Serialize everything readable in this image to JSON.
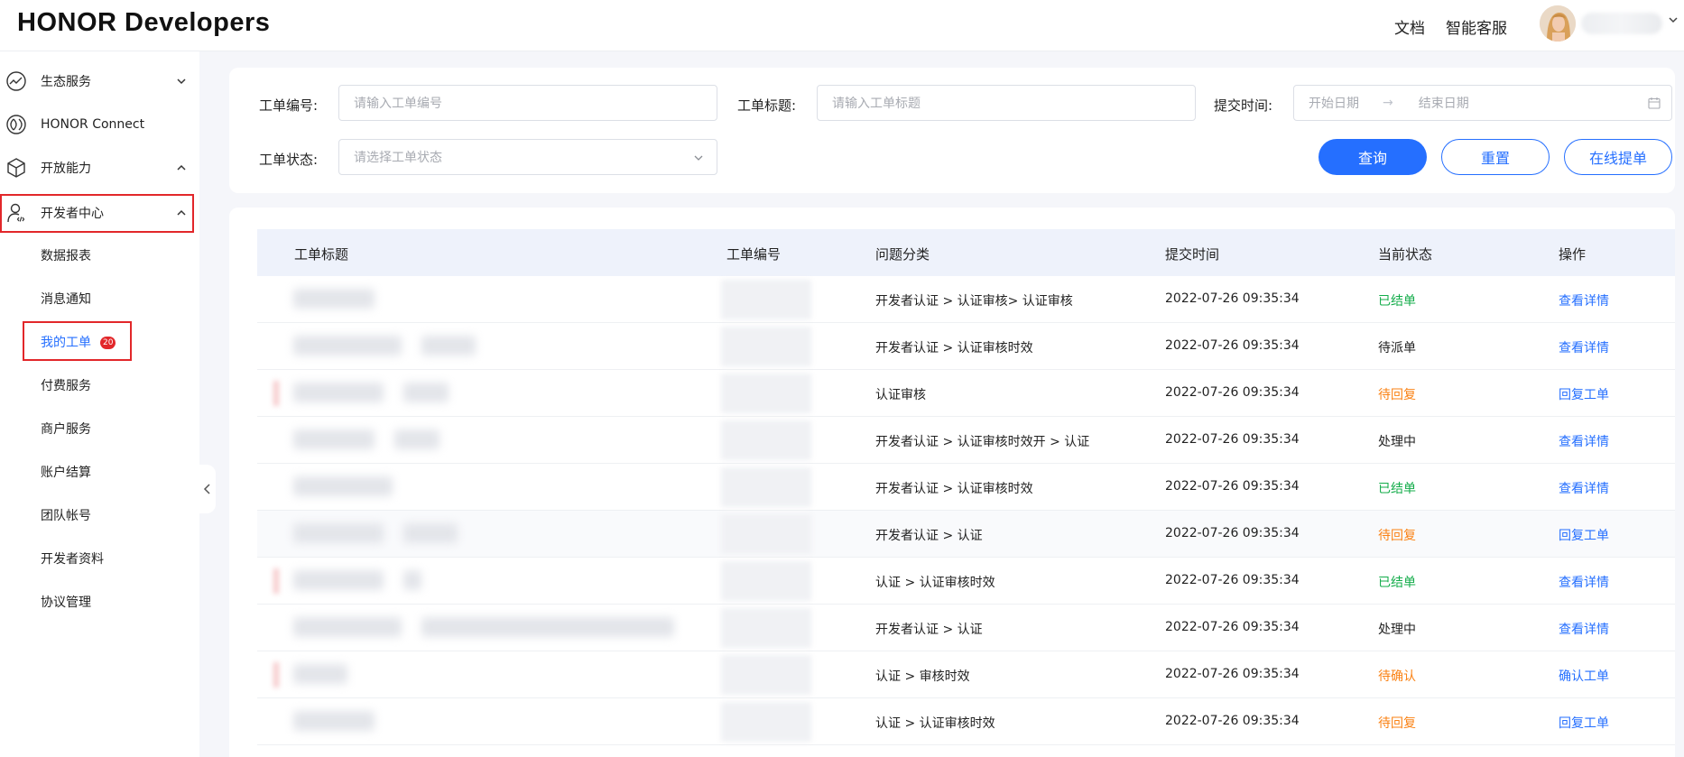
{
  "header": {
    "logo": "HONOR Developers",
    "links": [
      "文档",
      "智能客服"
    ]
  },
  "sidebar": {
    "items": [
      {
        "label": "生态服务",
        "icon": "trend-chart-icon",
        "caret": "down"
      },
      {
        "label": "HONOR Connect",
        "icon": "connect-icon",
        "caret": ""
      },
      {
        "label": "开放能力",
        "icon": "cube-icon",
        "caret": "up"
      },
      {
        "label": "开发者中心",
        "icon": "developer-user-icon",
        "caret": "up"
      }
    ],
    "sub_items": [
      {
        "label": "数据报表"
      },
      {
        "label": "消息通知"
      },
      {
        "label": "我的工单",
        "badge": "20",
        "active": true
      },
      {
        "label": "付费服务"
      },
      {
        "label": "商户服务"
      },
      {
        "label": "账户结算"
      },
      {
        "label": "团队帐号"
      },
      {
        "label": "开发者资料"
      },
      {
        "label": "协议管理"
      }
    ]
  },
  "filters": {
    "ticket_no_label": "工单编号:",
    "ticket_no_placeholder": "请输入工单编号",
    "ticket_title_label": "工单标题:",
    "ticket_title_placeholder": "请输入工单标题",
    "submit_time_label": "提交时间:",
    "start_date_placeholder": "开始日期",
    "date_separator": "→",
    "end_date_placeholder": "结束日期",
    "status_label": "工单状态:",
    "status_placeholder": "请选择工单状态",
    "query_button": "查询",
    "reset_button": "重置",
    "online_submit_button": "在线提单"
  },
  "table": {
    "columns": [
      "工单标题",
      "工单编号",
      "问题分类",
      "提交时间",
      "当前状态",
      "操作"
    ],
    "rows": [
      {
        "category": "开发者认证 > 认证审核> 认证审核",
        "time": "2022-07-26 09:35:34",
        "status": "已结单",
        "status_type": "done",
        "action": "查看详情"
      },
      {
        "category": "开发者认证 > 认证审核时效",
        "time": "2022-07-26 09:35:34",
        "status": "待派单",
        "status_type": "normal",
        "action": "查看详情"
      },
      {
        "category": "认证审核",
        "time": "2022-07-26 09:35:34",
        "status": "待回复",
        "status_type": "wait",
        "action": "回复工单"
      },
      {
        "category": "开发者认证 > 认证审核时效开 > 认证",
        "time": "2022-07-26 09:35:34",
        "status": "处理中",
        "status_type": "normal",
        "action": "查看详情"
      },
      {
        "category": "开发者认证 > 认证审核时效",
        "time": "2022-07-26 09:35:34",
        "status": "已结单",
        "status_type": "done",
        "action": "查看详情"
      },
      {
        "category": "开发者认证 > 认证",
        "time": "2022-07-26 09:35:34",
        "status": "待回复",
        "status_type": "wait",
        "action": "回复工单"
      },
      {
        "category": "认证 > 认证审核时效",
        "time": "2022-07-26 09:35:34",
        "status": "已结单",
        "status_type": "done",
        "action": "查看详情"
      },
      {
        "category": "开发者认证 > 认证",
        "time": "2022-07-26 09:35:34",
        "status": "处理中",
        "status_type": "normal",
        "action": "查看详情"
      },
      {
        "category": "认证 > 审核时效",
        "time": "2022-07-26 09:35:34",
        "status": "待确认",
        "status_type": "wait",
        "action": "确认工单"
      },
      {
        "category": "认证 > 认证审核时效",
        "time": "2022-07-26 09:35:34",
        "status": "待回复",
        "status_type": "wait",
        "action": "回复工单"
      }
    ]
  },
  "colors": {
    "accent": "#256fff",
    "done": "#13ac4a",
    "wait": "#fa8214",
    "highlight": "#e2272a"
  }
}
